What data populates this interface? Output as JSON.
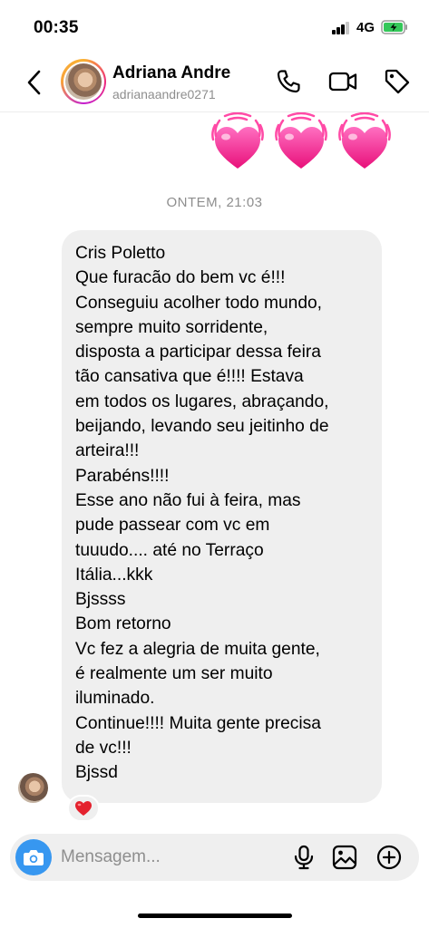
{
  "status_bar": {
    "time": "00:35",
    "network": "4G"
  },
  "header": {
    "contact_name": "Adriana Andre",
    "username": "adrianaandre0271",
    "icons": [
      "back-chevron-icon",
      "phone-icon",
      "video-camera-icon",
      "tag-icon"
    ]
  },
  "sent_reactions": [
    "beating-heart-emoji",
    "beating-heart-emoji",
    "beating-heart-emoji"
  ],
  "timestamp": "ONTEM, 21:03",
  "message": {
    "lines": [
      "Cris Poletto",
      "Que furacão do bem vc é!!!",
      "Conseguiu acolher todo mundo,",
      "sempre muito sorridente,",
      "disposta a participar dessa feira",
      "tão cansativa que é!!!! Estava",
      "em todos os lugares, abraçando,",
      "beijando, levando seu jeitinho de",
      "arteira!!!",
      "Parabéns!!!!",
      "Esse ano não fui à feira, mas",
      "pude passear com vc em",
      "tuuudo.... até no Terraço",
      "Itália...kkk",
      "Bjssss",
      "Bom retorno",
      "Vc fez a alegria de muita gente,",
      "é realmente um ser muito",
      "iluminado.",
      "Continue!!!! Muita gente precisa",
      "de vc!!!",
      "Bjssd"
    ],
    "reaction": "red-heart-emoji"
  },
  "composer": {
    "placeholder": "Mensagem...",
    "icons": [
      "camera-icon",
      "microphone-icon",
      "gallery-icon",
      "add-circle-icon"
    ]
  },
  "colors": {
    "accent_blue": "#3797f0",
    "bubble_gray": "#efefef",
    "heart_pink": "#f02d8c",
    "muted_text": "#8e8e8e"
  }
}
